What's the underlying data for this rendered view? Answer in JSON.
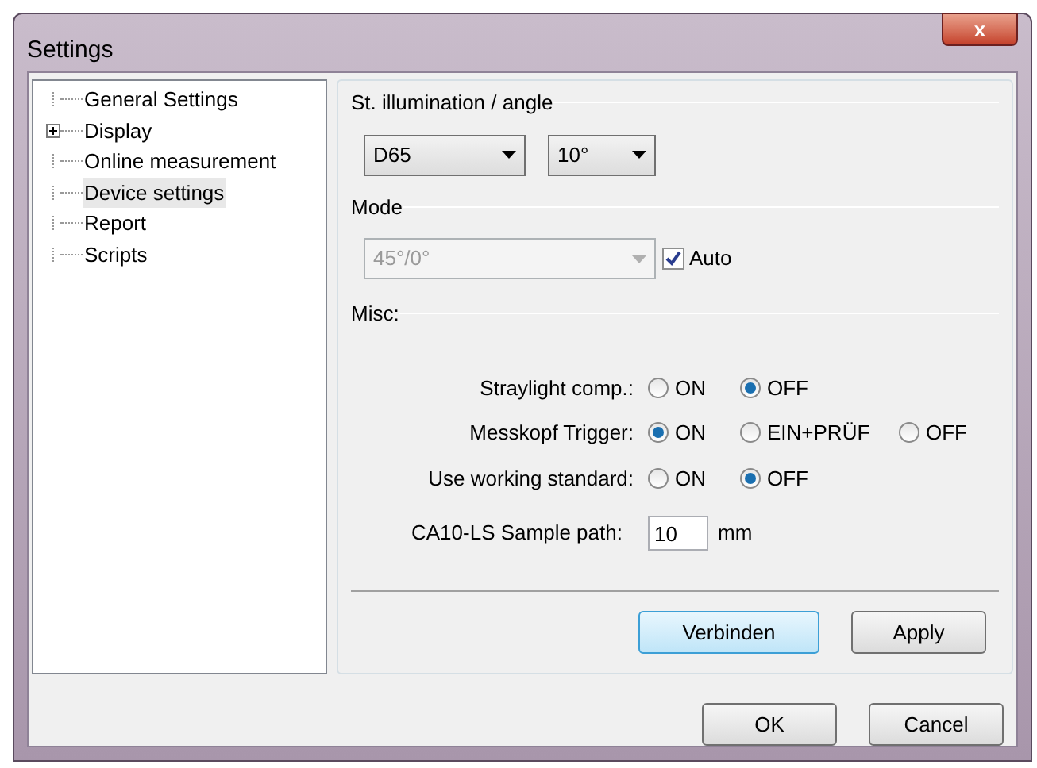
{
  "window": {
    "title": "Settings",
    "close": "x"
  },
  "tree": [
    {
      "label": "General Settings",
      "selected": false
    },
    {
      "label": "Display",
      "selected": false,
      "expanded": false
    },
    {
      "label": "Online measurement",
      "selected": false
    },
    {
      "label": "Device settings",
      "selected": true
    },
    {
      "label": "Report",
      "selected": false
    },
    {
      "label": "Scripts",
      "selected": false
    }
  ],
  "illumination": {
    "title": "St. illumination / angle",
    "dropdowns": [
      {
        "value": "D65"
      },
      {
        "value": "10°"
      }
    ]
  },
  "mode": {
    "title": "Mode",
    "dropdown": {
      "value": "45°/0°",
      "disabled": true
    },
    "auto": {
      "label": "Auto",
      "checked": true
    }
  },
  "misc": {
    "title": "Misc:",
    "rows": [
      {
        "label": "Straylight comp.:",
        "options": [
          {
            "label": "ON",
            "selected": false
          },
          {
            "label": "OFF",
            "selected": true
          }
        ]
      },
      {
        "label": "Messkopf Trigger:",
        "options": [
          {
            "label": "ON",
            "selected": true
          },
          {
            "label": "EIN+PRÜF",
            "selected": false
          },
          {
            "label": "OFF",
            "selected": false
          }
        ]
      },
      {
        "label": "Use working standard:",
        "options": [
          {
            "label": "ON",
            "selected": false
          },
          {
            "label": "OFF",
            "selected": true
          }
        ]
      }
    ],
    "sample_path": {
      "label": "CA10-LS Sample path:",
      "value": "10",
      "unit": "mm"
    }
  },
  "panel_buttons": [
    {
      "label": "Verbinden",
      "default": true
    },
    {
      "label": "Apply",
      "default": false
    }
  ],
  "dialog_buttons": [
    {
      "label": "OK"
    },
    {
      "label": "Cancel"
    }
  ]
}
